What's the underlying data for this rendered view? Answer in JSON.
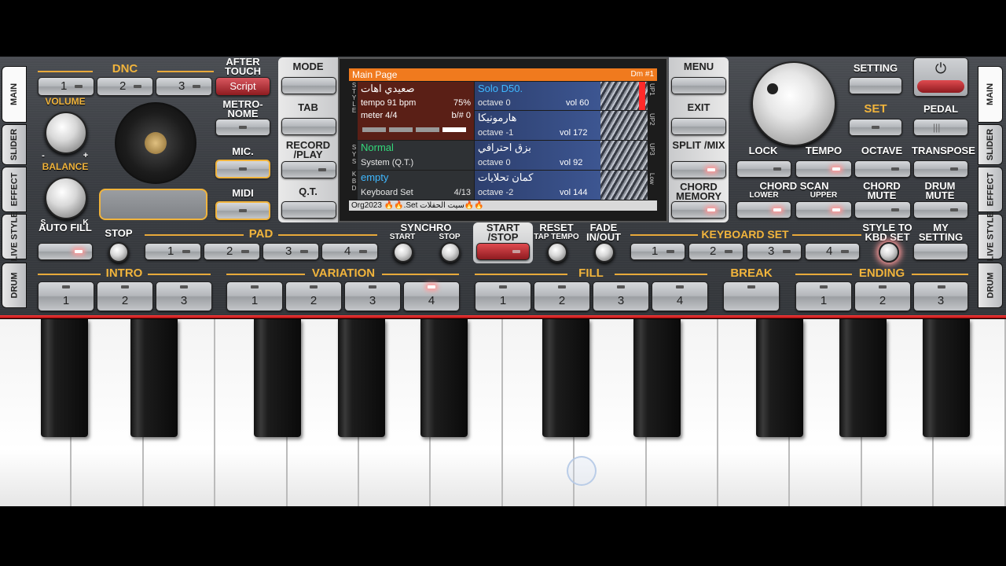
{
  "side_tabs": {
    "left": [
      "MAIN",
      "SLIDER",
      "EFFECT",
      "LIVE STYLE",
      "DRUM"
    ],
    "right": [
      "MAIN",
      "SLIDER",
      "EFFECT",
      "LIVE STYLE",
      "DRUM"
    ]
  },
  "top_left": {
    "dnc": "DNC",
    "dnc_buttons": [
      "1",
      "2",
      "3"
    ],
    "after_touch": "AFTER TOUCH",
    "script": "Script",
    "volume": "VOLUME",
    "balance": "BALANCE",
    "balance_s": "S",
    "balance_k": "K",
    "knob_minus": "-",
    "knob_plus": "+",
    "metronome": "METRO- NOME",
    "mic": "MIC.",
    "midi": "MIDI"
  },
  "left_col": {
    "mode": "MODE",
    "tab": "TAB",
    "record_play": "RECORD /PLAY",
    "qt": "Q.T."
  },
  "right_col": {
    "menu": "MENU",
    "exit": "EXIT",
    "split_mix": "SPLIT /MIX",
    "chord_memory": "CHORD MEMORY"
  },
  "screen": {
    "title": "Main Page",
    "chord": "Dm #1",
    "style_side": "STYLE",
    "sys_side": "SYS",
    "kbd_side": "KBD",
    "style_name": "صعيدي اهات",
    "tempo": "tempo 91 bpm",
    "tempo_pct": "75%",
    "meter": "meter 4/4",
    "bsharp": "b/# 0",
    "system_name": "Normal",
    "system_sub": "System (Q.T.)",
    "kbd_name": "empty",
    "kbd_sub": "Keyboard Set",
    "kbd_count": "4/13",
    "instruments": [
      {
        "name": "Solo D50.",
        "octave": "octave 0",
        "vol": "vol 60",
        "side": "UP1"
      },
      {
        "name": "هارمونيكا",
        "octave": "octave -1",
        "vol": "vol 172",
        "side": "UP2"
      },
      {
        "name": "بزق احترافي",
        "octave": "octave 0",
        "vol": "vol 92",
        "side": "UP3"
      },
      {
        "name": "كمان تحلايات",
        "octave": "octave -2",
        "vol": "vol 144",
        "side": "Low"
      }
    ],
    "footer": "Org2023 🔥🔥.Set سيت الحفلات🔥🔥"
  },
  "top_right": {
    "setting": "SETTING",
    "set": "SET",
    "pedal": "PEDAL",
    "lock": "LOCK",
    "tempo": "TEMPO",
    "octave": "OCTAVE",
    "transpose": "TRANSPOSE",
    "chord_scan": "CHORD SCAN",
    "lower": "LOWER",
    "upper": "UPPER",
    "chord_mute": "CHORD MUTE",
    "drum_mute": "DRUM MUTE"
  },
  "row3": {
    "auto_fill": "AUTO FILL",
    "stop": "STOP",
    "pad": "PAD",
    "pad_buttons": [
      "1",
      "2",
      "3",
      "4"
    ],
    "synchro": "SYNCHRO",
    "synchro_start": "START",
    "synchro_stop": "STOP",
    "start_stop": "START /STOP",
    "reset": "RESET",
    "tap_tempo": "TAP TEMPO",
    "fade": "FADE IN/OUT",
    "keyboard_set": "KEYBOARD SET",
    "kbd_buttons": [
      "1",
      "2",
      "3",
      "4"
    ],
    "style_to_kbd": "STYLE TO KBD SET",
    "my_setting": "MY SETTING"
  },
  "row4": {
    "intro": "INTRO",
    "intro_buttons": [
      "1",
      "2",
      "3"
    ],
    "variation": "VARIATION",
    "variation_buttons": [
      "1",
      "2",
      "3",
      "4"
    ],
    "fill": "FILL",
    "fill_buttons": [
      "1",
      "2",
      "3",
      "4"
    ],
    "break": "BREAK",
    "ending": "ENDING",
    "ending_buttons": [
      "1",
      "2",
      "3"
    ]
  },
  "colors": {
    "accent": "#f1b43c",
    "screen_header": "#f07a1e",
    "led_on": "#ffffff"
  }
}
